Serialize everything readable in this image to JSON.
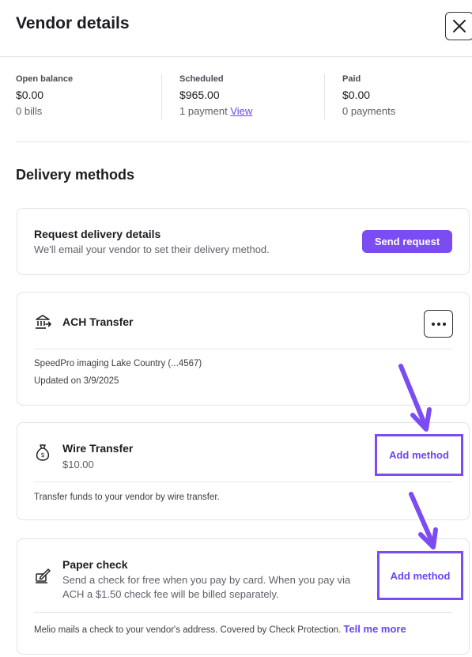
{
  "header": {
    "title": "Vendor details",
    "close_icon": "close-icon"
  },
  "summary": {
    "open_balance": {
      "label": "Open balance",
      "amount": "$0.00",
      "sub": "0 bills"
    },
    "scheduled": {
      "label": "Scheduled",
      "amount": "$965.00",
      "sub": "1 payment",
      "link": "View"
    },
    "paid": {
      "label": "Paid",
      "amount": "$0.00",
      "sub": "0 payments"
    }
  },
  "delivery": {
    "section_title": "Delivery methods",
    "request": {
      "title": "Request delivery details",
      "subtitle": "We'll email your vendor to set their delivery method.",
      "button": "Send request"
    },
    "ach": {
      "title": "ACH Transfer",
      "icon": "bank-icon",
      "account": "SpeedPro imaging Lake Country (...4567)",
      "updated": "Updated on 3/9/2025",
      "more_icon": "more-icon"
    },
    "wire": {
      "title": "Wire Transfer",
      "icon": "money-bag-icon",
      "fee": "$10.00",
      "button": "Add method",
      "description": "Transfer funds to your vendor by wire transfer."
    },
    "check": {
      "title": "Paper check",
      "icon": "check-edit-icon",
      "subtitle_line1": "Send a check for free when you pay by card. When you pay via",
      "subtitle_line2": "ACH a $1.50 check fee will be billed separately.",
      "button": "Add method",
      "description": "Melio mails a check to your vendor's address. Covered by Check Protection.",
      "link": "Tell me more"
    }
  },
  "colors": {
    "accent": "#7b4cf2",
    "link": "#6b45f0",
    "annotation": "#7b4cf2"
  }
}
